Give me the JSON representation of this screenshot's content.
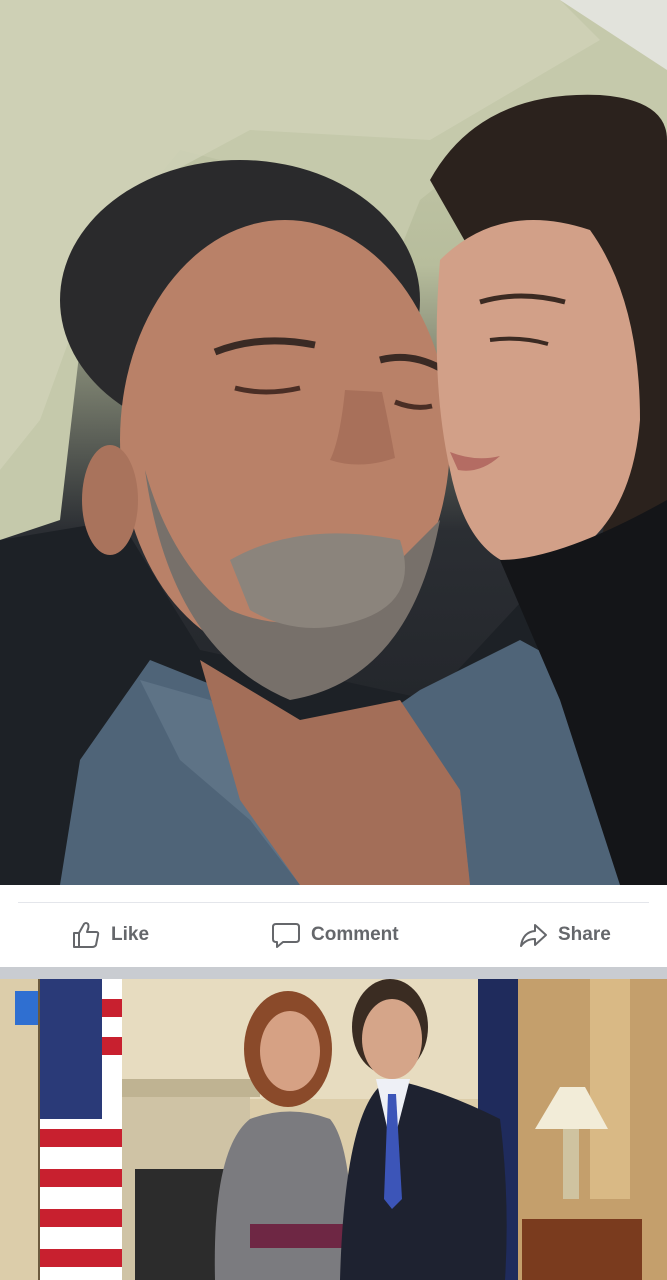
{
  "post": {
    "photo_icon": "couple-selfie-photo",
    "actions": {
      "like_label": "Like",
      "comment_label": "Comment",
      "share_label": "Share"
    },
    "icons": {
      "like": "thumbs-up-icon",
      "comment": "speech-bubble-icon",
      "share": "share-arrow-icon"
    }
  },
  "next_post": {
    "photo_icon": "formal-room-photo"
  },
  "colors": {
    "action_text": "#65676b",
    "separator": "#c9ccd1",
    "divider": "#e4e6eb"
  }
}
